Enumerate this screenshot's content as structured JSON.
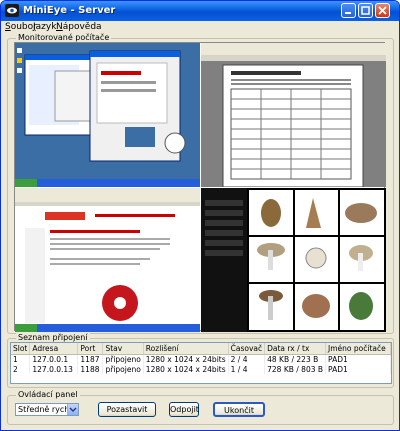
{
  "window": {
    "title": "MiniEye - Server"
  },
  "menu": [
    {
      "label": "Soubor",
      "hotkey": "S"
    },
    {
      "label": "Jazyk",
      "hotkey": "J"
    },
    {
      "label": "Nápověda",
      "hotkey": "N"
    }
  ],
  "monitored": {
    "label": "Monitorované počítače"
  },
  "connections": {
    "label": "Seznam připojení",
    "columns": [
      "Slot",
      "Adresa",
      "Port",
      "Stav",
      "Rozlišení",
      "Časovač",
      "Data rx / tx",
      "Jméno počítače"
    ],
    "rows": [
      [
        "1",
        "127.0.0.1",
        "1187",
        "připojeno",
        "1280 x 1024 x 24bits",
        "2 / 4",
        "48 KB / 223 B",
        "PAD1"
      ],
      [
        "2",
        "127.0.0.13",
        "1188",
        "připojeno",
        "1280 x 1024 x 24bits",
        "1 / 4",
        "728 KB / 803 B",
        "PAD1"
      ]
    ]
  },
  "control": {
    "label": "Ovládací panel",
    "speed_value": "Středně rychle",
    "pause_label": "Pozastavit",
    "disconnect_label": "Odpojit",
    "exit_label": "Ukončit"
  }
}
